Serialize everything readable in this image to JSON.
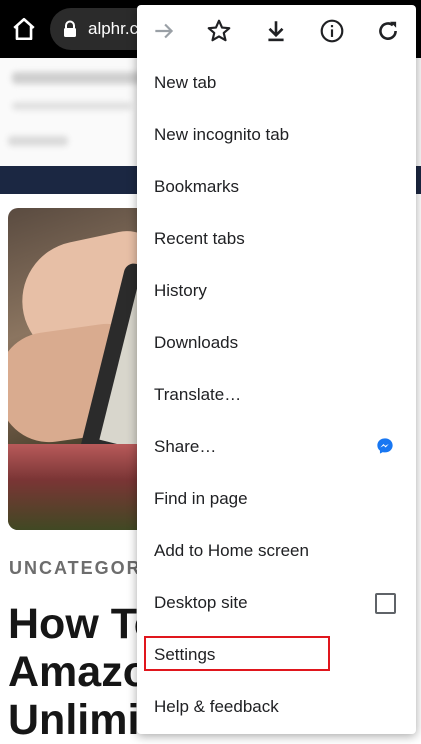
{
  "toolbar": {
    "url": "alphr.c",
    "home_icon": "home-icon",
    "lock_icon": "lock-icon"
  },
  "article": {
    "category": "UNCATEGOR",
    "headline_lines": [
      "How To",
      "Amazo",
      "Unlimi"
    ]
  },
  "menu": {
    "icons": [
      "forward-icon",
      "bookmark-star-icon",
      "download-icon",
      "info-icon",
      "reload-icon"
    ],
    "items": [
      {
        "label": "New tab"
      },
      {
        "label": "New incognito tab"
      },
      {
        "label": "Bookmarks"
      },
      {
        "label": "Recent tabs"
      },
      {
        "label": "History"
      },
      {
        "label": "Downloads"
      },
      {
        "label": "Translate…"
      },
      {
        "label": "Share…",
        "icon": "messenger-icon"
      },
      {
        "label": "Find in page"
      },
      {
        "label": "Add to Home screen"
      },
      {
        "label": "Desktop site",
        "checked": false
      },
      {
        "label": "Settings",
        "highlighted": true
      },
      {
        "label": "Help & feedback"
      }
    ]
  },
  "colors": {
    "highlight": "#e0161d",
    "toolbar_bg": "#000000",
    "banner": "#1b2742"
  }
}
